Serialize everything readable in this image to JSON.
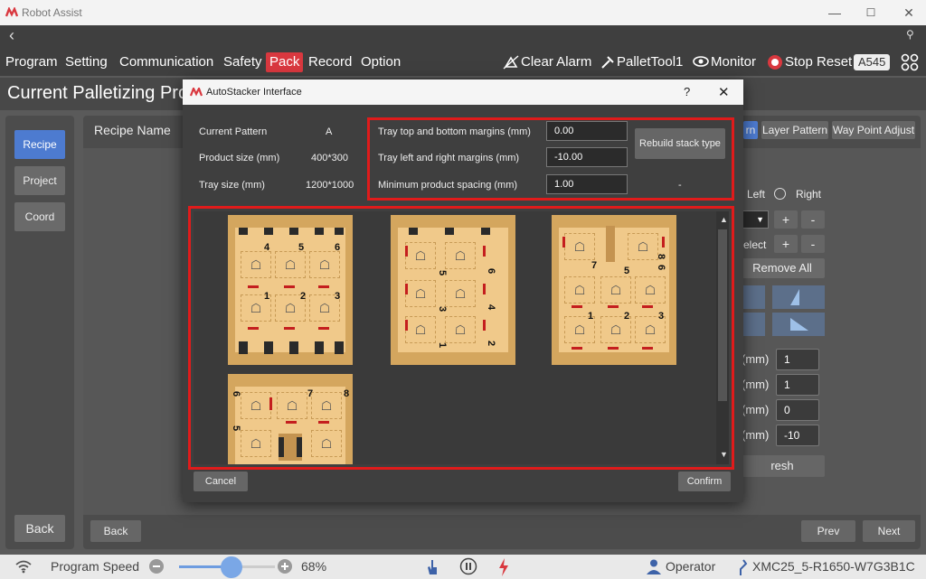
{
  "app": {
    "title": "Robot Assist"
  },
  "window": {
    "minimize": "—",
    "maximize": "☐",
    "close": "✕"
  },
  "nav": {
    "back_arrow": "‹",
    "search_glyph": "⚲"
  },
  "menu": {
    "items": [
      "Program",
      "Setting",
      "Communication",
      "Safety",
      "Pack",
      "Record",
      "Option"
    ],
    "active": "Pack"
  },
  "toolbar": {
    "clear_alarm": "Clear Alarm",
    "pallet_tool": "PalletTool1",
    "monitor": "Monitor",
    "stop_reset": "Stop Reset",
    "badge": "A545"
  },
  "header": {
    "title": "Current Palletizing Pro"
  },
  "sidebar": {
    "items": [
      "Recipe",
      "Project",
      "Coord"
    ],
    "back": "Back"
  },
  "main": {
    "recipe_label": "Recipe Name",
    "tab_pattern": "rn",
    "tab_layer": "Layer Pattern",
    "tab_waypoint": "Way Point Adjust",
    "left": "Left",
    "right": "Right",
    "select": "elect",
    "remove_all": "Remove All",
    "mm_label": "(mm)",
    "values": [
      "1",
      "1",
      "0",
      "-10"
    ],
    "refresh": "resh",
    "back": "Back",
    "prev": "Prev",
    "next": "Next",
    "plus": "+",
    "minus": "-"
  },
  "dialog": {
    "title": "AutoStacker Interface",
    "help": "?",
    "close": "✕",
    "current_pattern_label": "Current Pattern",
    "current_pattern": "A",
    "product_size_label": "Product size (mm)",
    "product_size": "400*300",
    "tray_size_label": "Tray size (mm)",
    "tray_size": "1200*1000",
    "tb_margin_label": "Tray top and bottom margins (mm)",
    "tb_margin": "0.00",
    "lr_margin_label": "Tray left and right margins (mm)",
    "lr_margin": "-10.00",
    "spacing_label": "Minimum product spacing (mm)",
    "spacing": "1.00",
    "dash": "-",
    "rebuild": "Rebuild stack type",
    "cancel": "Cancel",
    "confirm": "Confirm"
  },
  "patterns": [
    {
      "nums": [
        "4",
        "5",
        "6",
        "1",
        "2",
        "3"
      ]
    },
    {
      "nums": [
        "6",
        "5",
        "4",
        "3",
        "2",
        "1"
      ]
    },
    {
      "nums": [
        "7",
        "5",
        "8",
        "6",
        "1",
        "2",
        "3"
      ]
    },
    {
      "nums": [
        "6",
        "7",
        "8",
        "5"
      ]
    }
  ],
  "status": {
    "program_speed": "Program Speed",
    "speed": "68%",
    "operator": "Operator",
    "device": "XMC25_5-R1650-W7G3B1C"
  },
  "colors": {
    "accent": "#d9383f",
    "active_tab": "#4d7bd0",
    "highlight": "#e01b1b"
  }
}
